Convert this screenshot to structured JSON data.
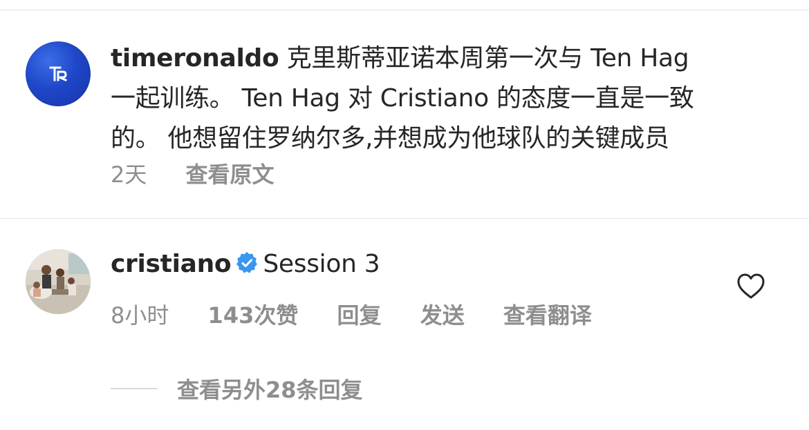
{
  "comments": [
    {
      "username": "timeronaldo",
      "text_lines": [
        "克里斯蒂亚诺本周第一次与 Ten Hag",
        "一起训练。 Ten Hag 对 Cristiano 的态度一直是一致",
        "的。 他想留住罗纳尔多,并想成为他球队的关键成员"
      ],
      "text_first": "克里斯蒂亚诺本周第一次与 Ten Hag",
      "text_second": "一起训练。 Ten Hag 对 Cristiano 的态度一直是一致",
      "text_third": "的。 他想留住罗纳尔多,并想成为他球队的关键成员",
      "time": "2天",
      "see_original": "查看原文",
      "avatar_icon": "tr-logo-avatar"
    },
    {
      "username": "cristiano",
      "verified": true,
      "text": "Session 3",
      "time": "8小时",
      "likes": "143次赞",
      "reply": "回复",
      "send": "发送",
      "see_translation": "查看翻译",
      "avatar_icon": "family-photo-avatar",
      "like_icon": "heart-icon"
    }
  ],
  "view_replies": "查看另外28条回复",
  "colors": {
    "primary_text": "#262626",
    "secondary_text": "#8e8e8e",
    "verified_blue": "#3897f0",
    "divider": "#e3e3e3",
    "tr_avatar_blue": "#1f47c9"
  }
}
